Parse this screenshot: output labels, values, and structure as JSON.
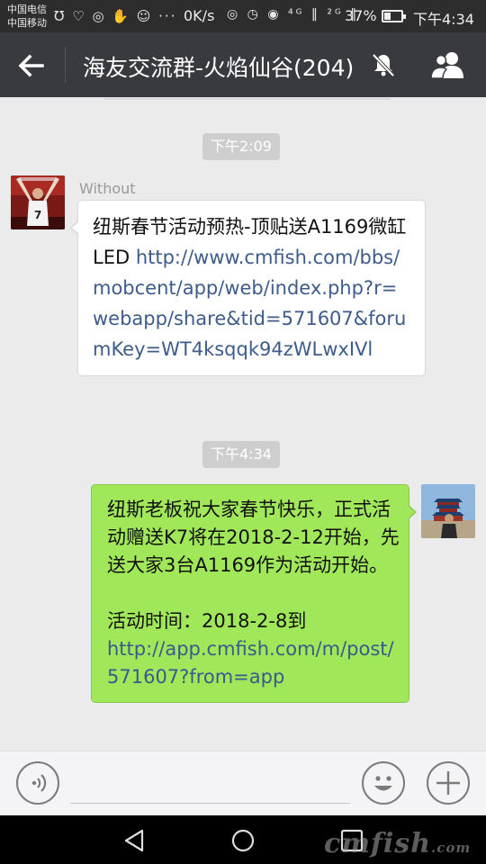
{
  "status_bar": {
    "carrier_1": "中国电信",
    "carrier_2": "中国移动",
    "icons": "Ʊ ♡ ◎ ✋ ☺ ···",
    "net_speed": "0K/s",
    "right_icons": "◎ ◷ ◉ ⁴ᴳ ‖ ²ᴳ ‖",
    "battery": "37%",
    "time": "下午4:34"
  },
  "header": {
    "title": "海友交流群-火焰仙谷(204)",
    "back_icon": "arrow-left",
    "mute_icon": "bell-off",
    "members_icon": "people"
  },
  "messages": [
    {
      "type": "timestamp",
      "text": "下午2:09"
    },
    {
      "type": "incoming",
      "sender": "Without",
      "text": "纽斯春节活动预热-顶贴送A1169微缸LED ",
      "link": "http://www.cmfish.com/bbs/mobcent/app/web/index.php?r=webapp/share&tid=571607&forumKey=WT4ksqqk94zWLwxIVl"
    },
    {
      "type": "timestamp",
      "text": "下午4:34"
    },
    {
      "type": "outgoing",
      "text": "纽斯老板祝大家春节快乐，正式活动赠送K7将在2018-2-12开始，先送大家3台A1169作为活动开始。",
      "text_2": "活动时间：2018-2-8到",
      "link": "http://app.cmfish.com/m/post/571607?from=app"
    }
  ],
  "input_bar": {
    "placeholder": "",
    "voice_icon": "voice",
    "emoji_icon": "smile",
    "plus_icon": "plus"
  },
  "watermark": {
    "main": "cmfish",
    "suffix": ".com"
  },
  "colors": {
    "title_bar": "#393a3f",
    "status_bar": "#2d2d2d",
    "chat_bg": "#ebebeb",
    "outgoing_bubble": "#a0e75a",
    "link": "#3d5c8c"
  }
}
